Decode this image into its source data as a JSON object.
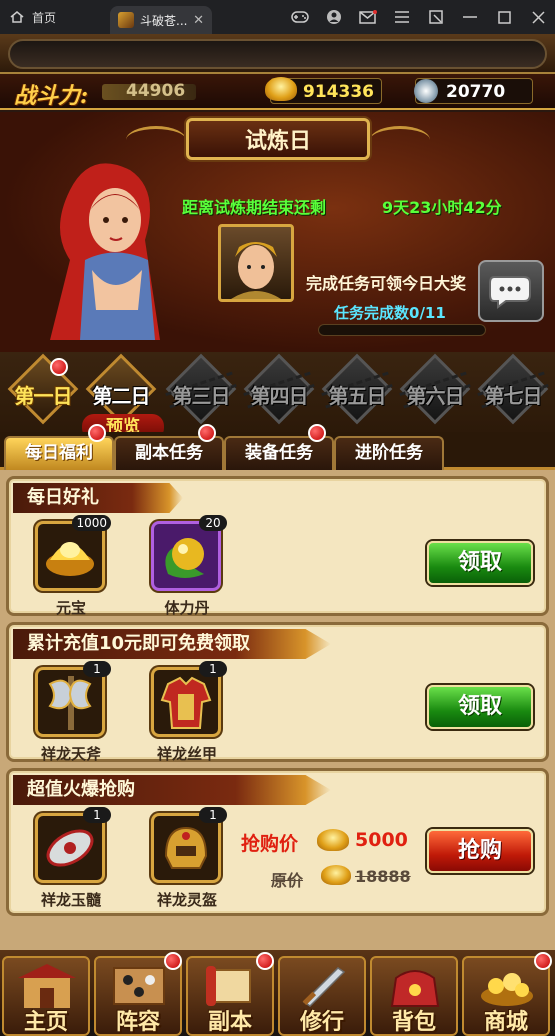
{
  "browser": {
    "home_tab": "首页",
    "active_tab": "斗破苍...",
    "close_glyph": "✕",
    "icons": [
      "gamepad-icon",
      "user-icon",
      "mail-icon",
      "menu-icon",
      "pin-icon",
      "minimize-icon",
      "maximize-icon",
      "close-icon"
    ]
  },
  "stats": {
    "power_label": "战斗力:",
    "power_value": "44906",
    "gold_value": "914336",
    "silver_value": "20770"
  },
  "banner": {
    "title": "试炼日",
    "countdown_label": "距离试炼期结束还剩",
    "countdown_value": "9天23小时42分",
    "task_reward_text": "完成任务可领今日大奖",
    "task_progress_label": "任务完成数0/11",
    "task_progress": 0.0
  },
  "day_tabs": {
    "items": [
      {
        "label": "第一日",
        "state": "active"
      },
      {
        "label": "第二日",
        "state": "open"
      },
      {
        "label": "第三日",
        "state": "locked"
      },
      {
        "label": "第四日",
        "state": "locked"
      },
      {
        "label": "第五日",
        "state": "locked"
      },
      {
        "label": "第六日",
        "state": "locked"
      },
      {
        "label": "第七日",
        "state": "locked"
      }
    ],
    "preview_label": "预览"
  },
  "task_tabs": [
    {
      "label": "每日福利",
      "active": true
    },
    {
      "label": "副本任务",
      "active": false
    },
    {
      "label": "装备任务",
      "active": false
    },
    {
      "label": "进阶任务",
      "active": false
    }
  ],
  "panels": {
    "daily": {
      "title": "每日好礼",
      "items": [
        {
          "name": "元宝",
          "count": "1000",
          "icon": "gold-ingot-icon"
        },
        {
          "name": "体力丹",
          "count": "20",
          "icon": "stamina-pill-icon"
        }
      ],
      "button": "领取"
    },
    "recharge": {
      "title": "累计充值10元即可免费领取",
      "items": [
        {
          "name": "祥龙天斧",
          "count": "1",
          "icon": "axe-icon"
        },
        {
          "name": "祥龙丝甲",
          "count": "1",
          "icon": "armor-icon"
        }
      ],
      "button": "领取"
    },
    "flash_sale": {
      "title": "超值火爆抢购",
      "items": [
        {
          "name": "祥龙玉髓",
          "count": "1",
          "icon": "jade-icon"
        },
        {
          "name": "祥龙灵盔",
          "count": "1",
          "icon": "helmet-icon"
        }
      ],
      "price_label": "抢购价",
      "price_value": "5000",
      "orig_label": "原价",
      "orig_value": "18888",
      "button": "抢购"
    }
  },
  "bottom_nav": [
    {
      "label": "主页",
      "icon": "palace-icon"
    },
    {
      "label": "阵容",
      "icon": "formation-icon"
    },
    {
      "label": "副本",
      "icon": "scroll-icon"
    },
    {
      "label": "修行",
      "icon": "sword-icon"
    },
    {
      "label": "背包",
      "icon": "bag-icon"
    },
    {
      "label": "商城",
      "icon": "treasure-icon"
    }
  ],
  "colors": {
    "countdown": "#5aff3a",
    "progress_text": "#5ae6ff",
    "gold_text": "#ffe45a",
    "price_red": "#e02010",
    "notify_dot": "#c00000"
  }
}
